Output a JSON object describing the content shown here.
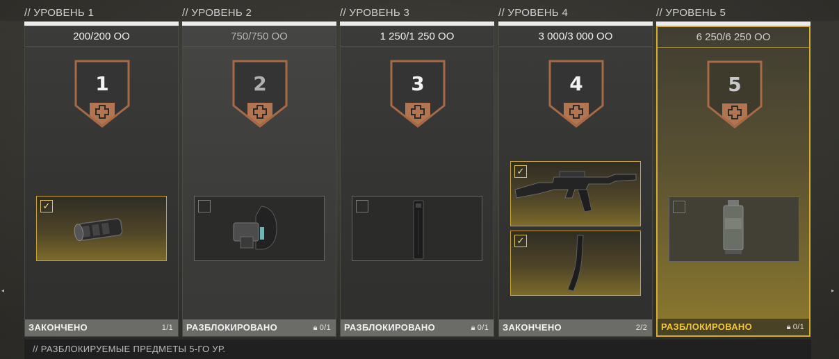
{
  "levels": [
    {
      "header": "// УРОВЕНЬ 1",
      "points": "200/200 ОО",
      "number": "1",
      "status": "ЗАКОНЧЕНО",
      "count": "1/1",
      "locked": false,
      "items": [
        {
          "name": "muzzle-device",
          "checked": true
        }
      ]
    },
    {
      "header": "// УРОВЕНЬ 2",
      "points": "750/750 ОО",
      "number": "2",
      "status": "РАЗБЛОКИРОВАНО",
      "count": "0/1",
      "locked": true,
      "items": [
        {
          "name": "stock-attachment",
          "checked": false
        }
      ]
    },
    {
      "header": "// УРОВЕНЬ 3",
      "points": "1 250/1 250 ОО",
      "number": "3",
      "status": "РАЗБЛОКИРОВАНО",
      "count": "0/1",
      "locked": true,
      "items": [
        {
          "name": "magazine",
          "checked": false
        }
      ]
    },
    {
      "header": "// УРОВЕНЬ 4",
      "points": "3 000/3 000 ОО",
      "number": "4",
      "status": "ЗАКОНЧЕНО",
      "count": "2/2",
      "locked": false,
      "items": [
        {
          "name": "rifle",
          "checked": true
        },
        {
          "name": "curved-magazine",
          "checked": true
        }
      ]
    },
    {
      "header": "// УРОВЕНЬ 5",
      "points": "6 250/6 250 ОО",
      "number": "5",
      "status": "РАЗБЛОКИРОВАНО",
      "count": "0/1",
      "locked": true,
      "items": [
        {
          "name": "grenade",
          "checked": false
        }
      ]
    }
  ],
  "footer": "// РАЗБЛОКИРУЕМЫЕ ПРЕДМЕТЫ 5-ГО УР.",
  "icons": {
    "check": "check-icon",
    "lock": "lock-icon",
    "plus": "medical-cross-icon"
  },
  "colors": {
    "accent": "#d7ad2c",
    "badge": "#a86a45"
  }
}
